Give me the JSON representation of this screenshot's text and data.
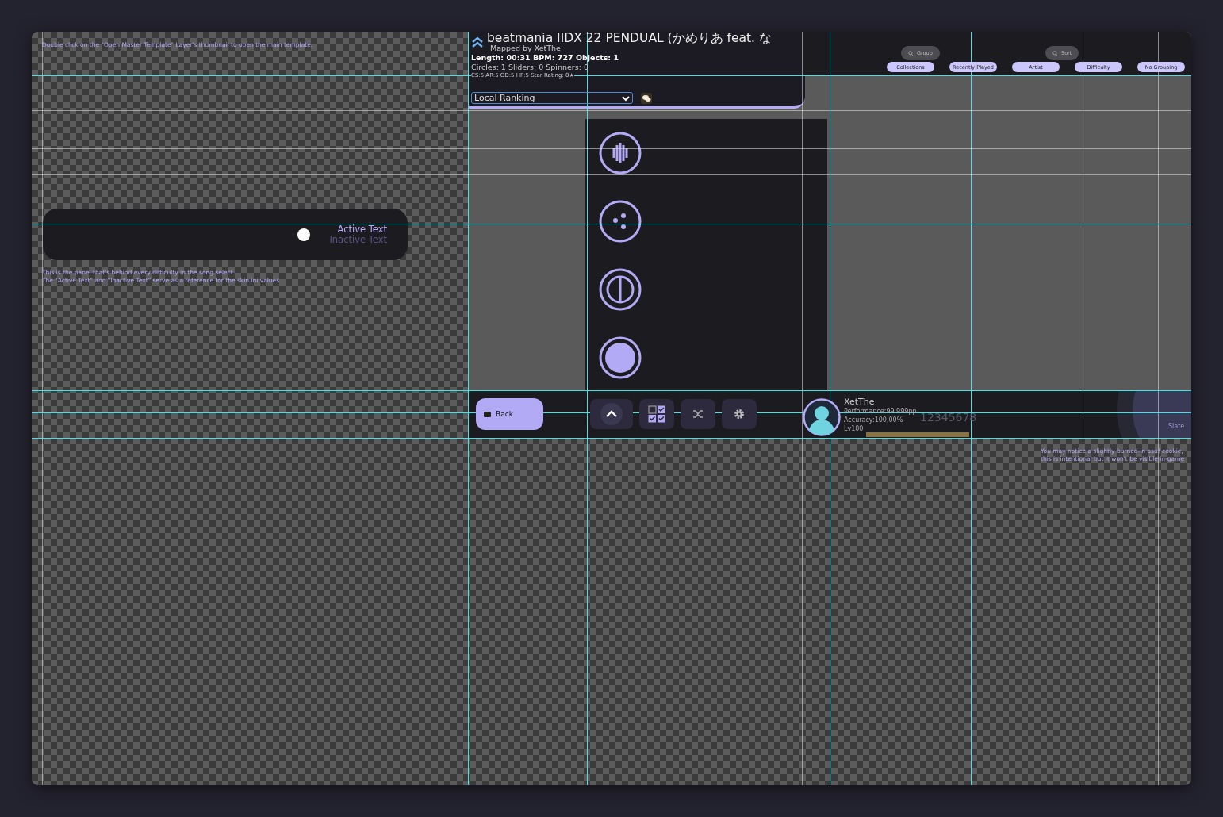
{
  "instruction": "Double click on the \"Open Master Template\" Layer's thumbnail to open the main template.",
  "difficulty_panel": {
    "active_text": "Active Text",
    "inactive_text": "Inactive Text"
  },
  "panel_note": [
    "This is the panel that's behind every difficulty in the song select.",
    "The \"Active Text\" and \"Inactive Text\" serve as a reference for the skin.ini values"
  ],
  "beatmap": {
    "title": "beatmania IIDX 22 PENDUAL (かめりあ feat. な",
    "mapper": "Mapped by XetThe",
    "stats": "Length: 00:31 BPM: 727 Objects: 1",
    "counts": "Circles: 1 Sliders: 0 Spinners: 0",
    "difficulty": "CS:5 AR:5 OD:5 HP:5 Star Rating: 0★"
  },
  "ranking": {
    "value": "Local Ranking"
  },
  "search_buttons": [
    "Group",
    "Sort"
  ],
  "group_tabs": [
    "Collections",
    "Recently Played",
    "Artist",
    "Difficulty",
    "No Grouping"
  ],
  "back_button": "Back",
  "player": {
    "name": "XetThe",
    "performance": "Performance:99,999pp",
    "accuracy": "Accuracy:100,00%",
    "level_text": "Lv100",
    "score": "12345678",
    "level": 1
  },
  "cookie_label": "Slate",
  "cookie_note": [
    "You may notice a slightly burned-in osu! cookie,",
    "this is intentional but it won't be visible in-game"
  ]
}
